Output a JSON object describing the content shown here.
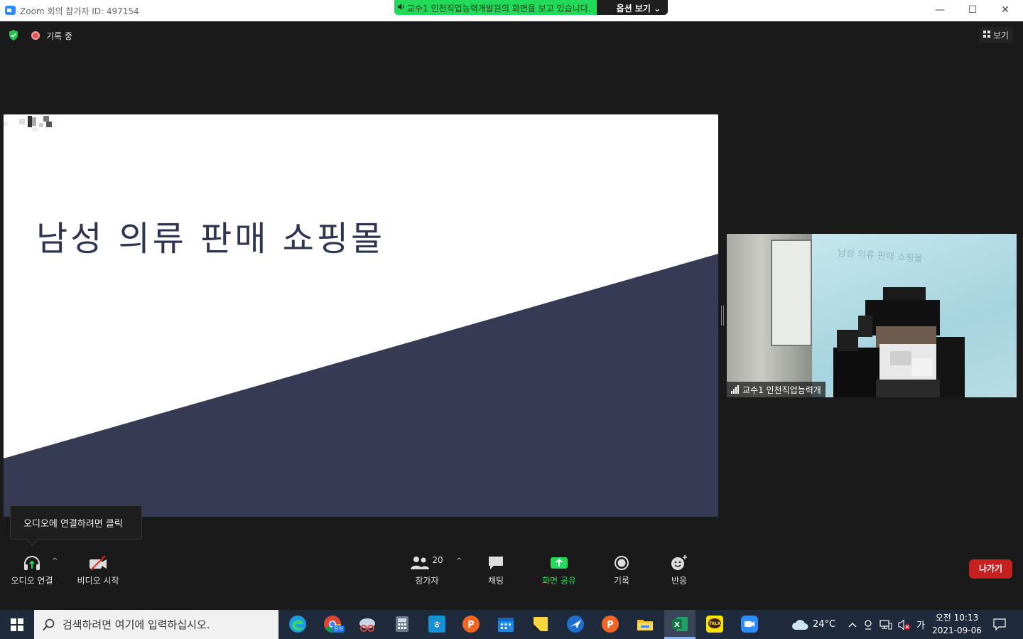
{
  "titlebar": {
    "title": "Zoom 회의 참가자 ID: 497154",
    "minimize_glyph": "—",
    "maximize_glyph": "☐",
    "close_glyph": "✕"
  },
  "share_banner": {
    "message": "교수1 인천직업능력개발원의 화면을 보고 있습니다.",
    "options_label": "옵션 보기 ⌄"
  },
  "meeting": {
    "recording_label": "기록 중",
    "view_label": "보기"
  },
  "slide": {
    "title": "남성 의류 판매 쇼핑몰",
    "colors": {
      "band": "#363a52",
      "title": "#2e3550"
    }
  },
  "video": {
    "name": "교수1 인천직업능력개",
    "board_text": "남성 의류 판매 쇼핑몰"
  },
  "tooltip": {
    "text": "오디오에 연결하려면 클릭"
  },
  "toolbar": {
    "audio_label": "오디오 연결",
    "video_label": "비디오 시작",
    "participants_label": "참가자",
    "participants_count": "20",
    "chat_label": "채팅",
    "share_label": "화면 공유",
    "record_label": "기록",
    "reactions_label": "반응",
    "leave_label": "나가기",
    "caret": "^",
    "share_color": "#23d959",
    "leave_color": "#c52121"
  },
  "taskbar": {
    "search_placeholder": "검색하려면 여기에 입력하십시오.",
    "weather": "24°C",
    "ime": "가",
    "time": "오전 10:13",
    "date": "2021-09-06",
    "chrome_badge": "진이",
    "kakao_label": "TALK"
  }
}
